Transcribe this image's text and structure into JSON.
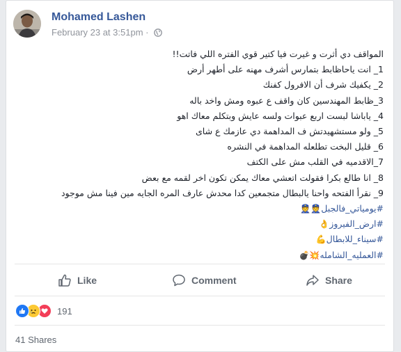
{
  "post": {
    "author": "Mohamed Lashen",
    "timestamp": "February 23 at 3:51pm",
    "separator": "·",
    "privacy_icon": "globe-icon",
    "lines": [
      "المواقف دي أثرت و غيرت فيا كتير قوي الفتره اللي فاتت!!",
      "1_ انت ياحاظابط بتمارس أشرف مهنه على أطهر أرض",
      "2_ يكفيك شرف أن الافرول كفنك",
      "3_ظابط المهندسين كان واقف ع عبوه ومش واخد باله",
      "4_ ياباشا لبست اربع عبوات ولسه عايش وبتكلم معاك اهو",
      "5_ ولو مستشهيدتش ف المداهمة دي عازمك ع شاى",
      "6_ قليل البخت تطلعله المداهمة في النشره",
      "7_الاقدميه في القلب مش على الكتف",
      "8_ انا طالع بكرا فقولت اتعشي معاك يمكن تكون اخر لقمه مع بعض",
      "9_ نقرأ الفتحه واحنا يالبطال متجمعين كدا محدش عارف المره الجايه مين فينا مش موجود"
    ],
    "hashtags": [
      {
        "text": "#يومياتي_فالجبل",
        "emoji": "👮👮"
      },
      {
        "text": "#ارض_الفيروز",
        "emoji": "👌"
      },
      {
        "text": "#سيناء_للابطال",
        "emoji": "💪"
      },
      {
        "text": "#العمليه_الشامله",
        "emoji": "💣💥"
      }
    ]
  },
  "actions": {
    "like_label": "Like",
    "comment_label": "Comment",
    "share_label": "Share"
  },
  "reactions": {
    "count": "191",
    "types": [
      "like-icon",
      "sad-icon",
      "love-icon"
    ]
  },
  "shares": {
    "label": "41 Shares"
  },
  "colors": {
    "link": "#365899",
    "like_blue": "#2078f4",
    "love_red": "#f33e58",
    "sad_yellow": "#fcc934"
  }
}
